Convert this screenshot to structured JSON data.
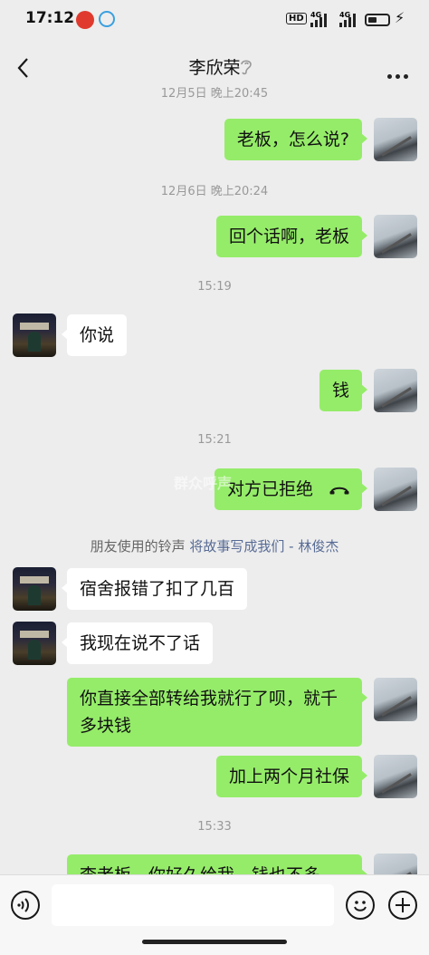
{
  "status_bar": {
    "time": "17:12",
    "hd": "HD",
    "network_1": "4G",
    "network_2": "4G",
    "battery_level": 0.45
  },
  "header": {
    "title": "李欣荣"
  },
  "messages": {
    "ts0": "12月5日 晚上20:45",
    "m1": "老板，怎么说?",
    "ts1": "12月6日 晚上20:24",
    "m2": "回个话啊，老板",
    "ts2": "15:19",
    "m3": "你说",
    "m4": "钱",
    "ts3": "15:21",
    "m5": "对方已拒绝",
    "ringtone_prefix": "朋友使用的铃声 ",
    "ringtone_song": "将故事写成我们 - 林俊杰",
    "m6": "宿舍报错了扣了几百",
    "m7": "我现在说不了话",
    "m8_line1": "你直接全部转给我就行了呗，就千",
    "m8_line2": "多块钱",
    "m9": "加上两个月社保",
    "ts4": "15:33",
    "m10": "李老板，你好久给我，钱也不多"
  },
  "watermark": "群众呼声",
  "colors": {
    "background": "#ededed",
    "bubble_me": "#95ec69",
    "bubble_them": "#ffffff",
    "link": "#576b95"
  },
  "icons": [
    "back-arrow-icon",
    "ear-icon",
    "more-icon",
    "voice-icon",
    "emoji-icon",
    "plus-icon",
    "call-declined-icon"
  ]
}
